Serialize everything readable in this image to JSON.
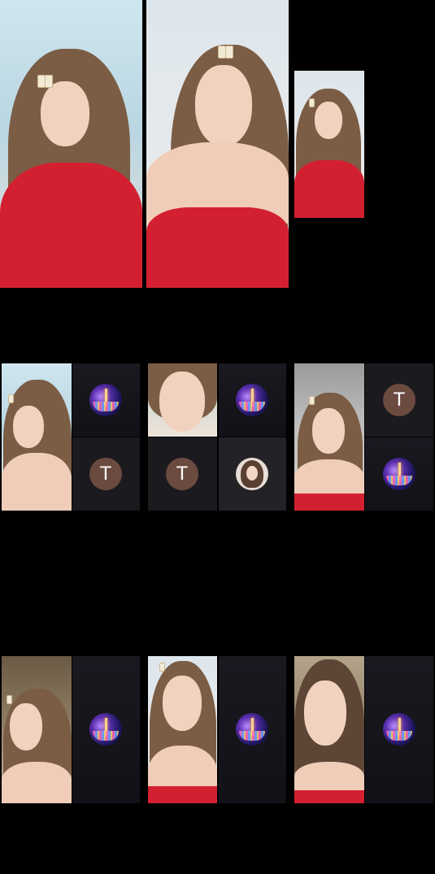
{
  "screen": {
    "background": "#000000"
  },
  "top_row": {
    "feeds": [
      {
        "name": "host-feed-1"
      },
      {
        "name": "host-feed-2"
      },
      {
        "name": "host-feed-3-small"
      }
    ]
  },
  "guest_grid": {
    "letter_avatar_initial": "T",
    "tile_icons": [
      "city-night-avatar-icon",
      "letter-avatar-icon",
      "profile-photo-avatar-icon"
    ]
  },
  "colors": {
    "tile_background": "#1b1a1f",
    "letter_avatar": "#6b4a40",
    "dress_red": "#d32030"
  }
}
